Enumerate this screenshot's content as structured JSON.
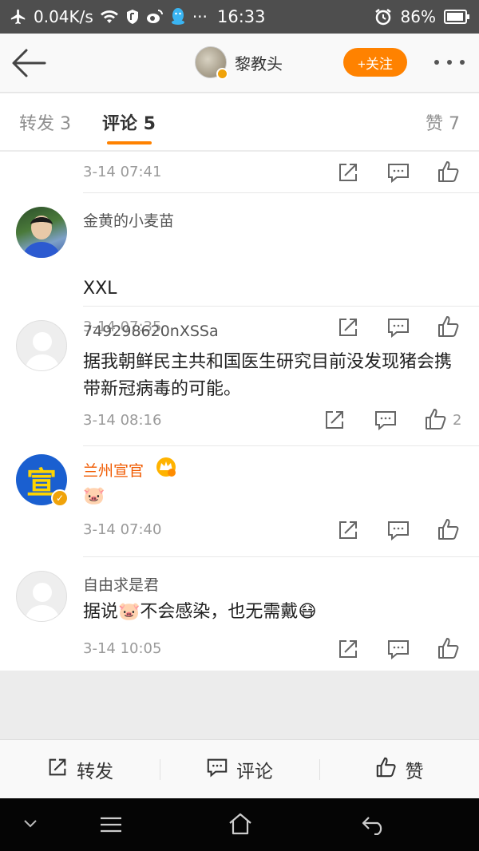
{
  "status_bar": {
    "net_speed": "0.04K/s",
    "time": "16:33",
    "battery": "86%",
    "ellipsis": "···"
  },
  "header": {
    "name": "黎教头",
    "follow_label": "+关注"
  },
  "tabs": {
    "repost": "转发 3",
    "comment": "评论 5",
    "like": "赞 7"
  },
  "comments": [
    {
      "timestamp": "3-14 07:41"
    },
    {
      "username": "金黄的小麦苗",
      "text": "XXL",
      "timestamp": "3-14 07:35"
    },
    {
      "username": "749298620nXSSa",
      "text": "据我朝鲜民主共和国医生研究目前没发现猪会携带新冠病毒的可能。",
      "timestamp": "3-14 08:16",
      "likes": "2"
    },
    {
      "username": "兰州宣官",
      "avatar_text": "宣",
      "text": "🐷",
      "timestamp": "3-14 07:40"
    },
    {
      "username": "自由求是君",
      "text": "据说🐷不会感染，也无需戴😷",
      "timestamp": "3-14 10:05"
    }
  ],
  "bottom_bar": {
    "repost": "转发",
    "comment": "评论",
    "like": "赞"
  },
  "colors": {
    "accent": "#ff8200",
    "verified_name": "#f05a00"
  }
}
